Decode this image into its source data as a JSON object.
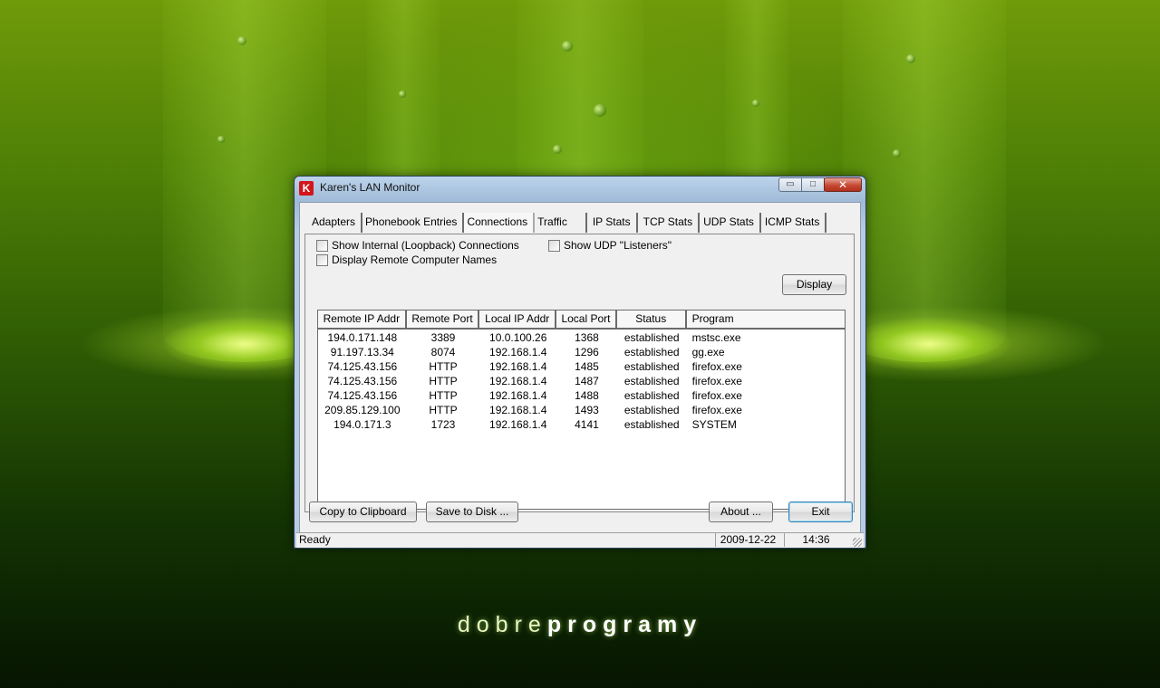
{
  "window": {
    "title": "Karen's LAN Monitor",
    "icon_letter": "K",
    "minimize_symbol": "▭",
    "maximize_symbol": "□",
    "close_symbol": "✕"
  },
  "tabs": [
    {
      "label": "Adapters",
      "selected": false
    },
    {
      "label": "Phonebook Entries",
      "selected": false
    },
    {
      "label": "Connections",
      "selected": true
    },
    {
      "label": "Traffic",
      "selected": false
    },
    {
      "label": "IP Stats",
      "selected": false
    },
    {
      "label": "TCP Stats",
      "selected": false
    },
    {
      "label": "UDP Stats",
      "selected": false
    },
    {
      "label": "ICMP Stats",
      "selected": false
    }
  ],
  "options": {
    "show_loopback": {
      "label": "Show Internal (Loopback) Connections",
      "checked": false
    },
    "show_udp_listeners": {
      "label": "Show UDP \"Listeners\"",
      "checked": false
    },
    "display_remote_names": {
      "label": "Display Remote Computer Names",
      "checked": false
    }
  },
  "display_button": "Display",
  "connections": {
    "columns": [
      "Remote IP Addr",
      "Remote Port",
      "Local IP Addr",
      "Local Port",
      "Status",
      "Program"
    ],
    "rows": [
      [
        "194.0.171.148",
        "3389",
        "10.0.100.26",
        "1368",
        "established",
        "mstsc.exe"
      ],
      [
        "91.197.13.34",
        "8074",
        "192.168.1.4",
        "1296",
        "established",
        "gg.exe"
      ],
      [
        "74.125.43.156",
        "HTTP",
        "192.168.1.4",
        "1485",
        "established",
        "firefox.exe"
      ],
      [
        "74.125.43.156",
        "HTTP",
        "192.168.1.4",
        "1487",
        "established",
        "firefox.exe"
      ],
      [
        "74.125.43.156",
        "HTTP",
        "192.168.1.4",
        "1488",
        "established",
        "firefox.exe"
      ],
      [
        "209.85.129.100",
        "HTTP",
        "192.168.1.4",
        "1493",
        "established",
        "firefox.exe"
      ],
      [
        "194.0.171.3",
        "1723",
        "192.168.1.4",
        "4141",
        "established",
        "SYSTEM"
      ]
    ]
  },
  "buttons": {
    "copy": "Copy to Clipboard",
    "save": "Save to Disk ...",
    "about": "About ...",
    "exit": "Exit"
  },
  "statusbar": {
    "status": "Ready",
    "date": "2009-12-22",
    "time": "14:36"
  },
  "wallpaper": {
    "brand_light": "dobre",
    "brand_bold": "programy"
  },
  "colors": {
    "wallpaper_green": "#4e7f06",
    "app_icon_red": "#d2161b",
    "close_button_red": "#c64a35",
    "exit_focus_blue": "#3c7fb1"
  }
}
